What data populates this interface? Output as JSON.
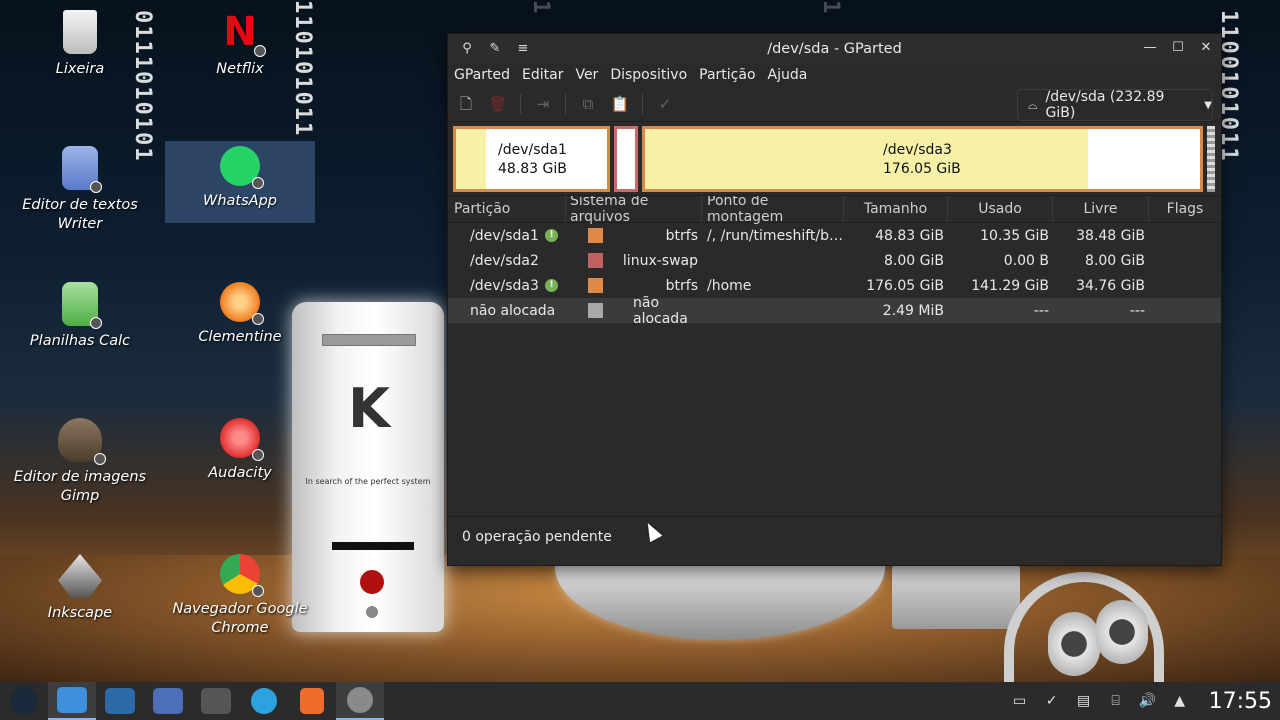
{
  "wallpaper": {
    "binary_columns": [
      "0111010101",
      "110101011",
      "1100101011",
      "1"
    ],
    "case_text": "In search of the perfect system"
  },
  "desktop_icons": [
    {
      "label": "Lixeira",
      "icon": "trash-icon"
    },
    {
      "label": "Netflix",
      "icon": "netflix-icon"
    },
    {
      "label": "Editor de textos Writer",
      "icon": "writer-icon"
    },
    {
      "label": "WhatsApp",
      "icon": "whatsapp-icon"
    },
    {
      "label": "Planilhas Calc",
      "icon": "calc-icon"
    },
    {
      "label": "Clementine",
      "icon": "clementine-icon"
    },
    {
      "label": "Editor de imagens Gimp",
      "icon": "gimp-icon"
    },
    {
      "label": "Audacity",
      "icon": "audacity-icon"
    },
    {
      "label": "Inkscape",
      "icon": "inkscape-icon"
    },
    {
      "label": "Navegador Google Chrome",
      "icon": "chrome-icon"
    }
  ],
  "window": {
    "title": "/dev/sda - GParted",
    "menu": [
      "GParted",
      "Editar",
      "Ver",
      "Dispositivo",
      "Partição",
      "Ajuda"
    ],
    "device": "/dev/sda (232.89 GiB)",
    "partition_map": [
      {
        "name": "/dev/sda1",
        "size": "48.83 GiB"
      },
      {
        "name": "/dev/sda3",
        "size": "176.05 GiB"
      }
    ],
    "columns": [
      "Partição",
      "Sistema de arquivos",
      "Ponto de montagem",
      "Tamanho",
      "Usado",
      "Livre",
      "Flags"
    ],
    "rows": [
      {
        "partition": "/dev/sda1",
        "fs": "btrfs",
        "mount": "/, /run/timeshift/b…",
        "size": "48.83 GiB",
        "used": "10.35 GiB",
        "free": "38.48 GiB",
        "color": "#e08a48",
        "info": true
      },
      {
        "partition": "/dev/sda2",
        "fs": "linux-swap",
        "mount": "",
        "size": "8.00 GiB",
        "used": "0.00 B",
        "free": "8.00 GiB",
        "color": "#c06060",
        "info": false
      },
      {
        "partition": "/dev/sda3",
        "fs": "btrfs",
        "mount": "/home",
        "size": "176.05 GiB",
        "used": "141.29 GiB",
        "free": "34.76 GiB",
        "color": "#e08a48",
        "info": true
      },
      {
        "partition": "não alocada",
        "fs": "não alocada",
        "mount": "",
        "size": "2.49 MiB",
        "used": "---",
        "free": "---",
        "color": "#a8a8a8",
        "info": false
      }
    ],
    "status": "0 operação pendente"
  },
  "taskbar": {
    "clock": "17:55"
  }
}
